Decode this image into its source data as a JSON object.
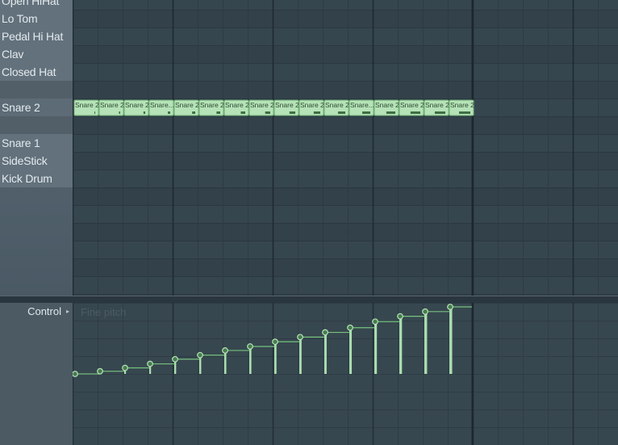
{
  "channels": [
    {
      "label": "Open HiHat"
    },
    {
      "label": "Lo Tom"
    },
    {
      "label": "Pedal Hi Hat"
    },
    {
      "label": "Clav"
    },
    {
      "label": "Closed Hat"
    },
    {
      "label": ""
    },
    {
      "label": "Snare 2"
    },
    {
      "label": ""
    },
    {
      "label": "Snare 1"
    },
    {
      "label": "SideStick"
    },
    {
      "label": "Kick Drum"
    }
  ],
  "notes": {
    "labels": [
      "Snare 2",
      "Snare 2",
      "Snare 2",
      "Snare...",
      "Snare 2",
      "Snare 2",
      "Snare 2",
      "Snare 2",
      "Snare 2",
      "Snare 2",
      "Snare 2",
      "Snare...",
      "Snare 2",
      "Snare 2",
      "Snare 2",
      "Snare 2"
    ],
    "fine_pitch": [
      0.0,
      0.04,
      0.09,
      0.15,
      0.22,
      0.28,
      0.35,
      0.41,
      0.48,
      0.55,
      0.62,
      0.69,
      0.78,
      0.86,
      0.93,
      1.0
    ]
  },
  "control": {
    "label": "Control",
    "arrow": "▸",
    "parameter": "Fine pitch"
  },
  "colors": {
    "note_fill": "#b6e2b8",
    "note_border": "#6fae73",
    "bar": "#a9dcae",
    "line": "#76c17e",
    "grid_row_a": "#36464f",
    "grid_row_b": "#32414a"
  }
}
